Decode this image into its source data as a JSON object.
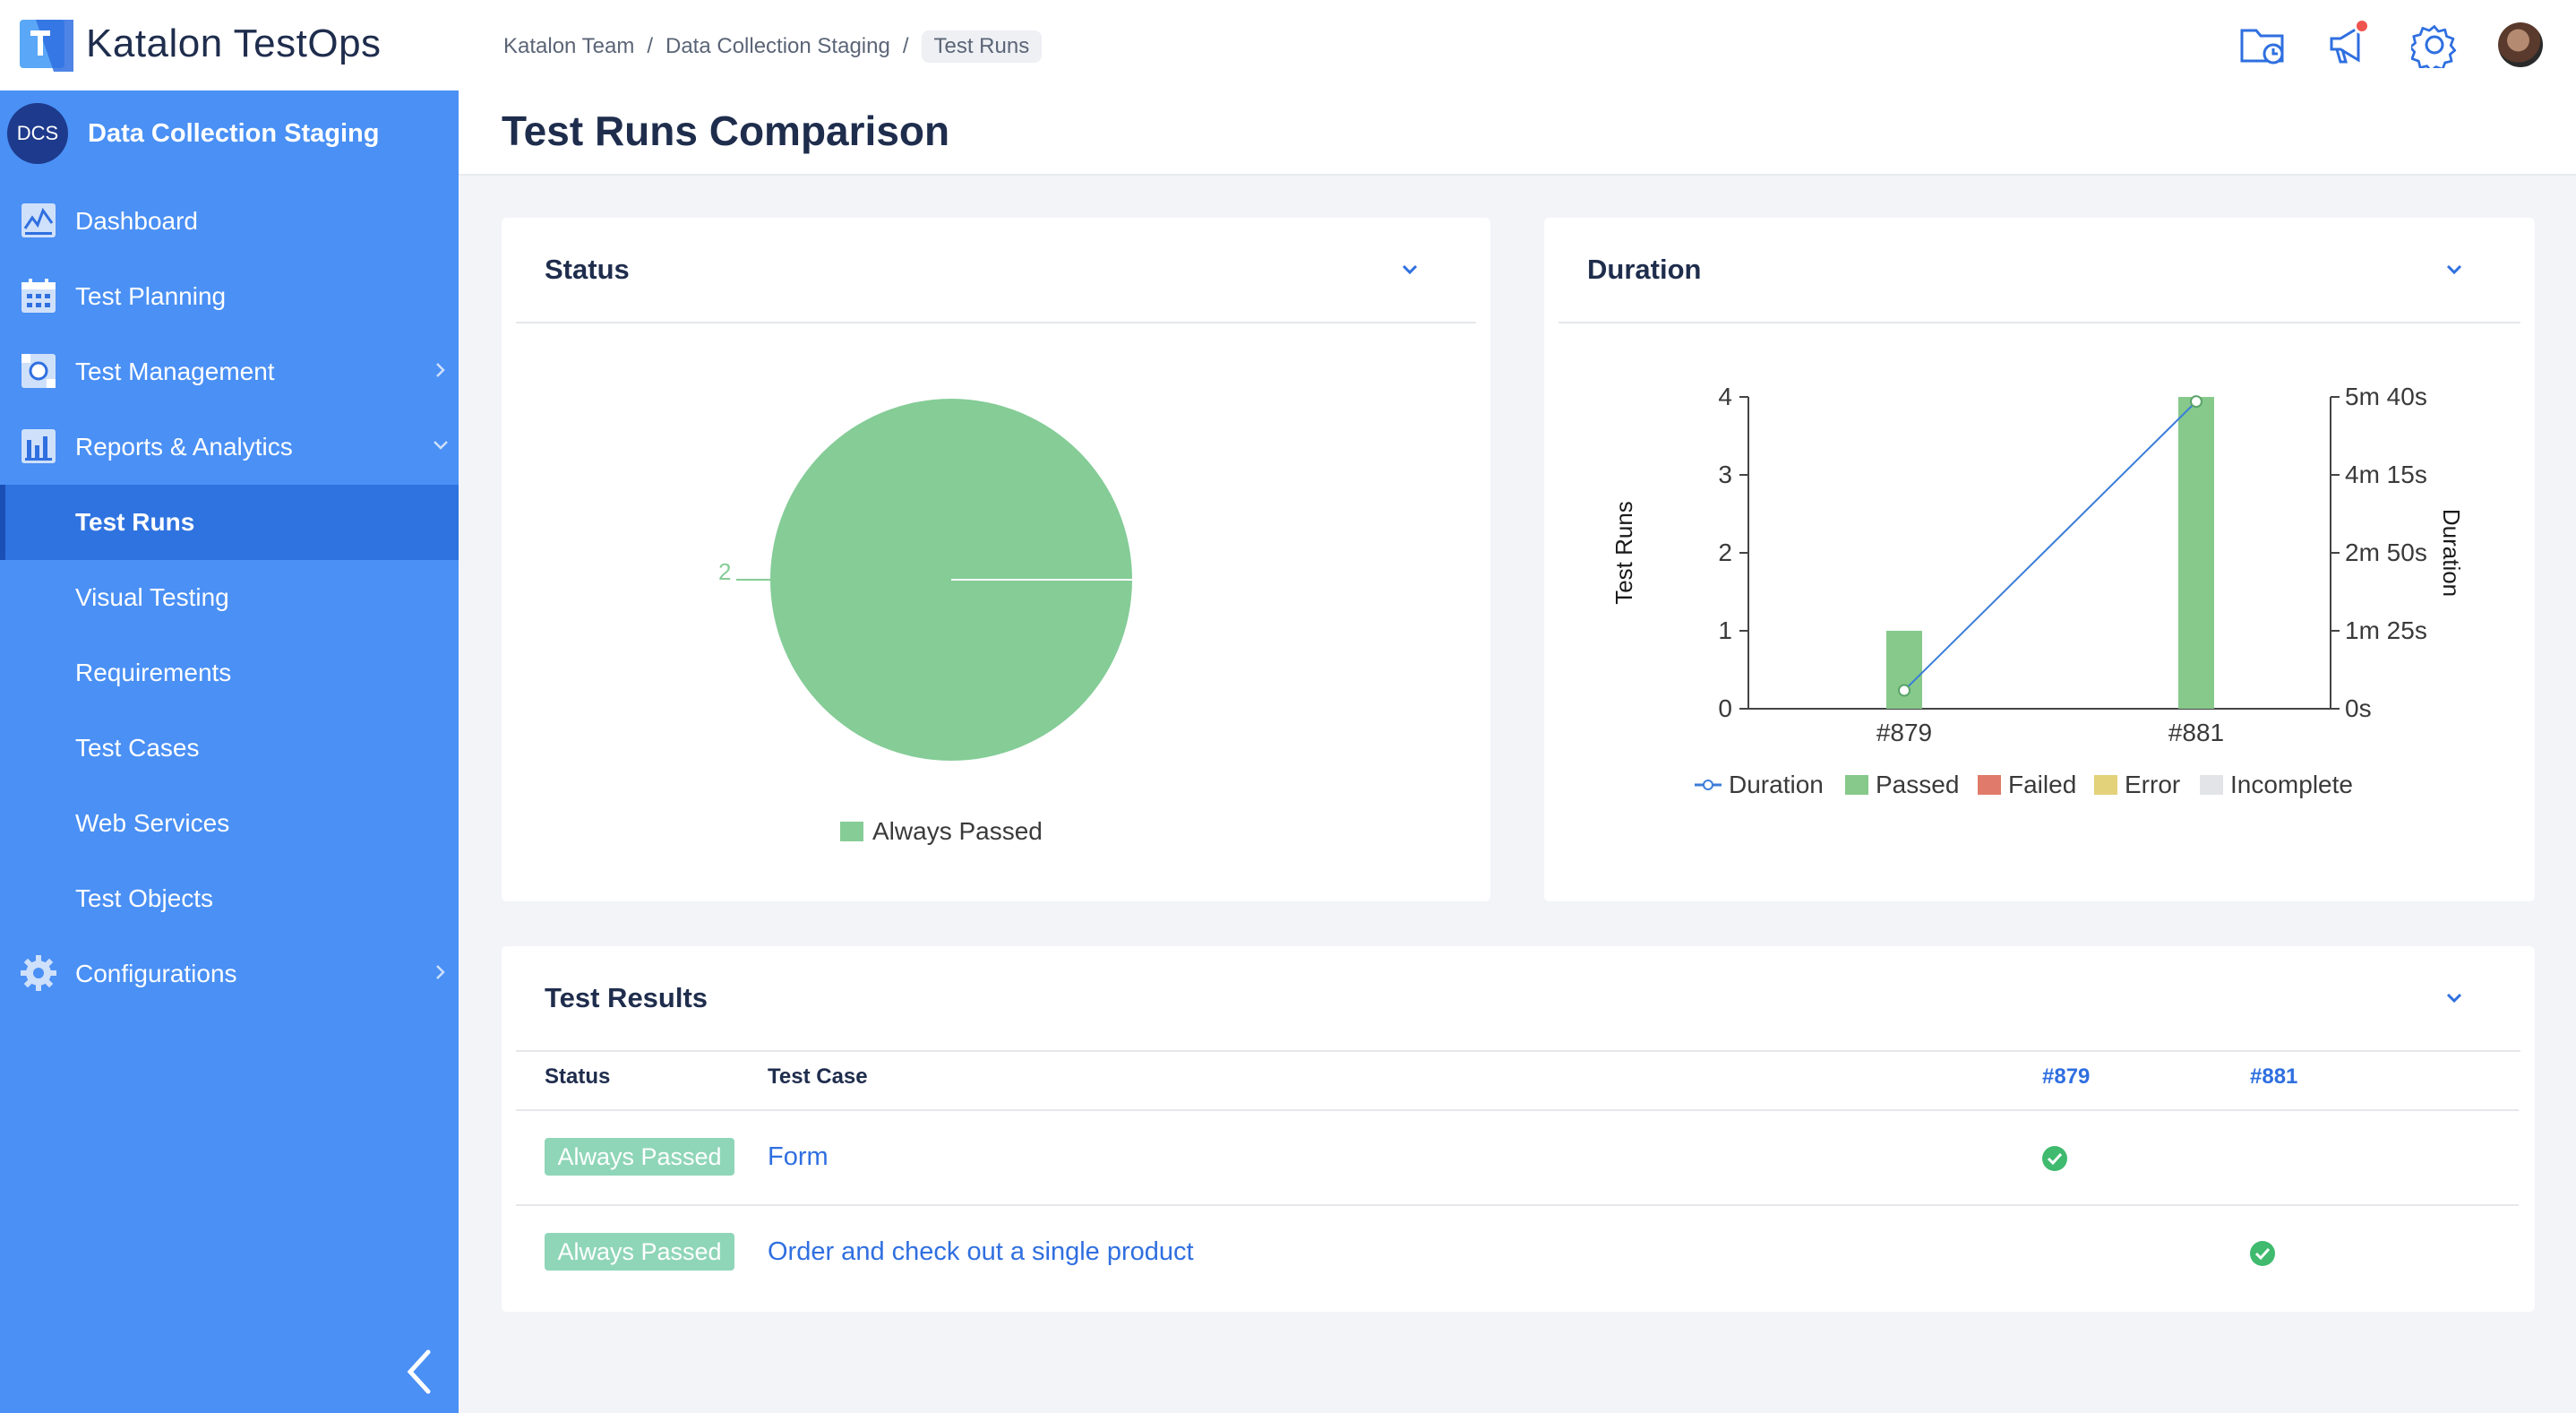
{
  "app": {
    "name": "Katalon TestOps"
  },
  "breadcrumb": [
    "Katalon Team",
    "Data Collection Staging",
    "Test Runs"
  ],
  "header_icons": [
    "scheduled-folder-icon",
    "announcement-icon",
    "settings-icon",
    "user-avatar"
  ],
  "project": {
    "badge": "DCS",
    "name": "Data Collection Staging"
  },
  "sidebar": {
    "items": [
      {
        "label": "Dashboard",
        "icon": "dashboard-icon"
      },
      {
        "label": "Test Planning",
        "icon": "calendar-icon"
      },
      {
        "label": "Test Management",
        "icon": "test-management-icon",
        "expandable": true
      },
      {
        "label": "Reports & Analytics",
        "icon": "reports-icon",
        "expanded": true
      },
      {
        "label": "Test Runs",
        "active": true
      },
      {
        "label": "Visual Testing"
      },
      {
        "label": "Requirements"
      },
      {
        "label": "Test Cases"
      },
      {
        "label": "Web Services"
      },
      {
        "label": "Test Objects"
      },
      {
        "label": "Configurations",
        "icon": "gear-icon",
        "expandable": true
      }
    ]
  },
  "page": {
    "title": "Test Runs Comparison"
  },
  "status_card": {
    "title": "Status",
    "pie_label": "2",
    "legend": "Always Passed"
  },
  "duration_card": {
    "title": "Duration",
    "left_axis_label": "Test Runs",
    "right_axis_label": "Duration",
    "left_ticks": [
      "0",
      "1",
      "2",
      "3",
      "4"
    ],
    "right_ticks": [
      "0s",
      "1m 25s",
      "2m 50s",
      "4m 15s",
      "5m 40s"
    ],
    "categories": [
      "#879",
      "#881"
    ],
    "legend": [
      "Duration",
      "Passed",
      "Failed",
      "Error",
      "Incomplete"
    ]
  },
  "results_card": {
    "title": "Test Results",
    "columns": [
      "Status",
      "Test Case",
      "#879",
      "#881"
    ],
    "rows": [
      {
        "status": "Always Passed",
        "test_case": "Form",
        "run_879": "passed",
        "run_881": ""
      },
      {
        "status": "Always Passed",
        "test_case": "Order and check out a single product",
        "run_879": "",
        "run_881": "passed"
      }
    ]
  },
  "colors": {
    "sidebar": "#4a90f5",
    "sidebar_active": "#2f73e0",
    "passed": "#86c98a",
    "pie": "#85cc97",
    "failed": "#e07a6a",
    "error": "#e3d27a",
    "incomplete": "#e2e4e8",
    "duration_line": "#3b7dd8",
    "link": "#2f6fe0",
    "badge": "#8fd6b8"
  },
  "chart_data": [
    {
      "type": "pie",
      "title": "Status",
      "categories": [
        "Always Passed"
      ],
      "values": [
        2
      ]
    },
    {
      "type": "bar",
      "title": "Duration",
      "categories": [
        "#879",
        "#881"
      ],
      "series": [
        {
          "name": "Passed",
          "values": [
            1,
            4
          ]
        },
        {
          "name": "Failed",
          "values": [
            0,
            0
          ]
        },
        {
          "name": "Error",
          "values": [
            0,
            0
          ]
        },
        {
          "name": "Incomplete",
          "values": [
            0,
            0
          ]
        }
      ],
      "line_series": {
        "name": "Duration",
        "axis": "right",
        "values_seconds": [
          20,
          335
        ]
      },
      "ylabel": "Test Runs",
      "ylim": [
        0,
        4
      ],
      "y2label": "Duration",
      "y2lim_seconds": [
        0,
        340
      ],
      "legend_position": "bottom"
    }
  ]
}
